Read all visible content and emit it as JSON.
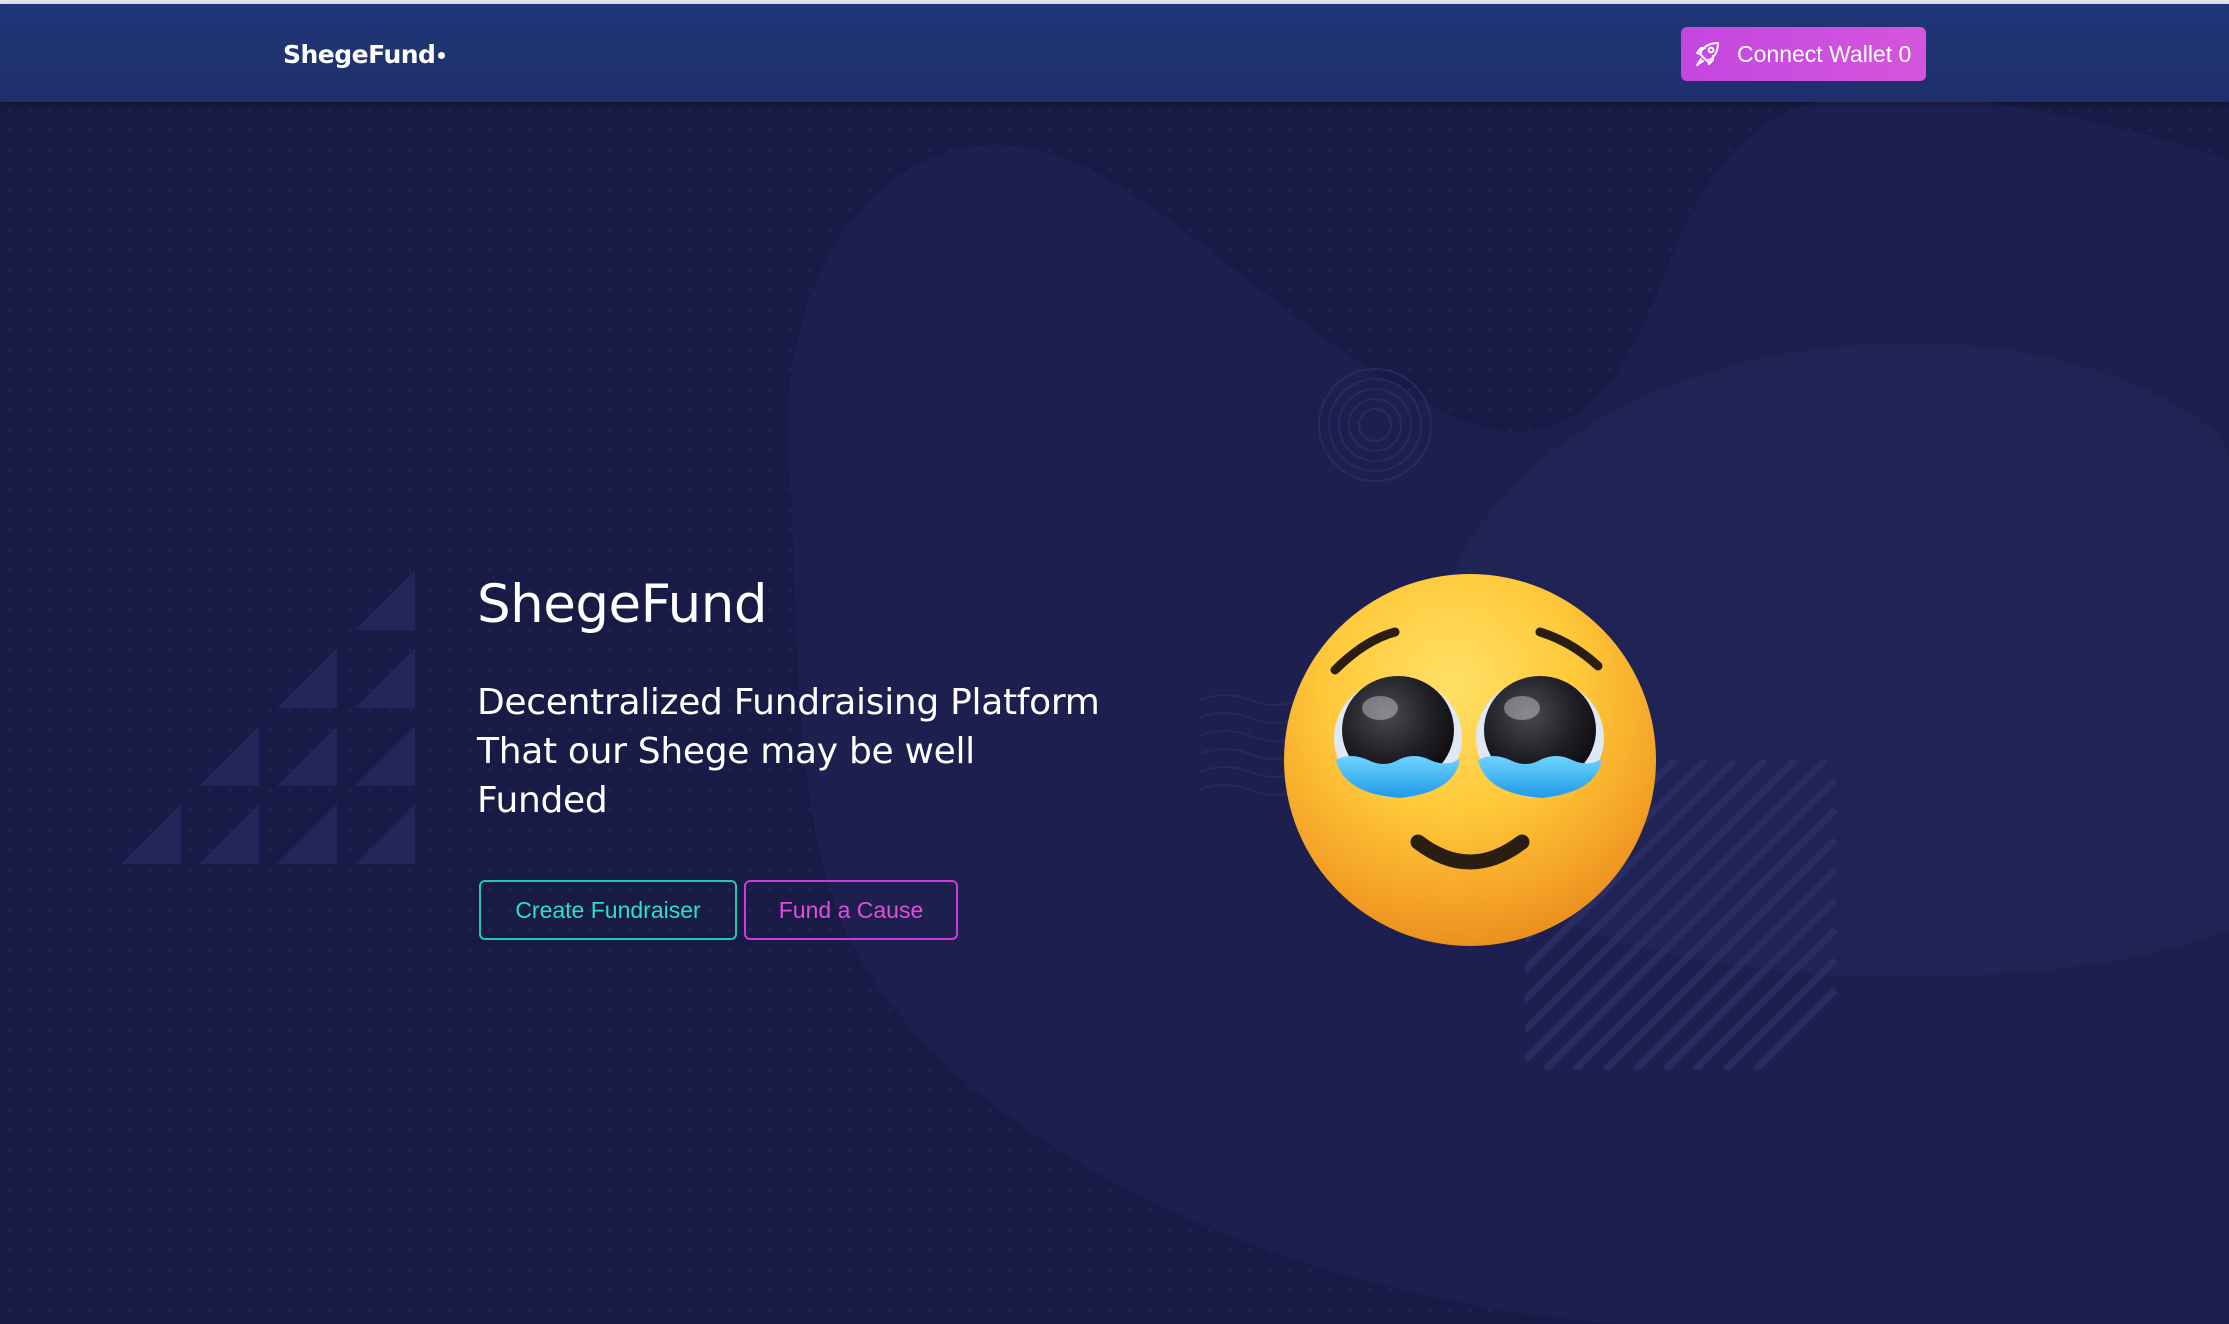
{
  "header": {
    "brand": "ShegeFund",
    "wallet_button": {
      "label": "Connect Wallet 0",
      "icon": "rocket-icon"
    }
  },
  "hero": {
    "title": "ShegeFund",
    "subtitle_lines": [
      "Decentralized Fundraising Platform",
      "That our Shege may be well",
      "Funded"
    ],
    "buttons": {
      "create": "Create Fundraiser",
      "fund": "Fund a Cause"
    },
    "illustration": "pleading-face-emoji"
  },
  "colors": {
    "background": "#181b45",
    "navbar": "#213678",
    "wallet_button": "#c446e0",
    "create_accent": "#1fc7b0",
    "fund_accent": "#d13ad6",
    "text": "#ffffff"
  }
}
